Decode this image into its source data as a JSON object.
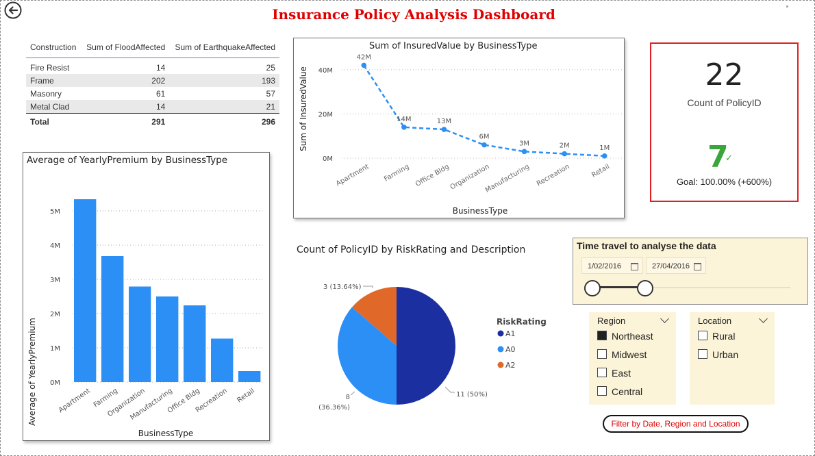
{
  "header": {
    "title": "Insurance Policy Analysis Dashboard",
    "back_icon": "arrow-left-circle-icon"
  },
  "table": {
    "columns": [
      "Construction",
      "Sum of FloodAffected",
      "Sum of EarthquakeAffected"
    ],
    "rows": [
      {
        "construction": "Fire Resist",
        "flood": "14",
        "quake": "25"
      },
      {
        "construction": "Frame",
        "flood": "202",
        "quake": "193"
      },
      {
        "construction": "Masonry",
        "flood": "61",
        "quake": "57"
      },
      {
        "construction": "Metal Clad",
        "flood": "14",
        "quake": "21"
      }
    ],
    "total": {
      "label": "Total",
      "flood": "291",
      "quake": "296"
    }
  },
  "kpi": {
    "count": "22",
    "count_label": "Count of PolicyID",
    "value": "7",
    "goal": "Goal: 100.00% (+600%)",
    "value_color": "#3aa53a",
    "border_color": "#e02020"
  },
  "time_slicer": {
    "title": "Time travel to analyse the data",
    "start_date": "1/02/2016",
    "end_date": "27/04/2016"
  },
  "region_filter": {
    "title": "Region",
    "options": [
      {
        "label": "Northeast",
        "checked": true
      },
      {
        "label": "Midwest",
        "checked": false
      },
      {
        "label": "East",
        "checked": false
      },
      {
        "label": "Central",
        "checked": false
      }
    ]
  },
  "location_filter": {
    "title": "Location",
    "options": [
      {
        "label": "Rural",
        "checked": false
      },
      {
        "label": "Urban",
        "checked": false
      }
    ]
  },
  "filter_note": "Filter by Date, Region and Location",
  "chart_data": [
    {
      "type": "bar",
      "title": "Average of YearlyPremium by BusinessType",
      "xlabel": "BusinessType",
      "ylabel": "Average of YearlyPremium",
      "categories": [
        "Apartment",
        "Farming",
        "Organization",
        "Manufacturing",
        "Office Bldg",
        "Recreation",
        "Retail"
      ],
      "values": [
        5340000,
        3680000,
        2790000,
        2500000,
        2240000,
        1270000,
        320000
      ],
      "ylim": [
        0,
        5500000
      ],
      "yticks": [
        "0M",
        "1M",
        "2M",
        "3M",
        "4M",
        "5M"
      ],
      "grid": true,
      "color": "#2b8ff5"
    },
    {
      "type": "line",
      "title": "Sum of InsuredValue by BusinessType",
      "xlabel": "BusinessType",
      "ylabel": "Sum of InsuredValue",
      "categories": [
        "Apartment",
        "Farming",
        "Office Bldg",
        "Organization",
        "Manufacturing",
        "Recreation",
        "Retail"
      ],
      "values": [
        42000000,
        14000000,
        13000000,
        6000000,
        3000000,
        2000000,
        1000000
      ],
      "data_labels": [
        "42M",
        "14M",
        "13M",
        "6M",
        "3M",
        "2M",
        "1M"
      ],
      "ylim": [
        0,
        48000000
      ],
      "yticks": [
        "0M",
        "20M",
        "40M"
      ],
      "grid": true,
      "line_style": "dashed",
      "color": "#2b8ff5"
    },
    {
      "type": "pie",
      "title": "Count of PolicyID by RiskRating and Description",
      "legend_title": "RiskRating",
      "legend_position": "right",
      "slices": [
        {
          "label": "A1",
          "value": 11,
          "text": "11 (50%)",
          "color": "#1c2fa0"
        },
        {
          "label": "A0",
          "value": 8,
          "text": "8 (36.36%)",
          "color": "#2b8ff5"
        },
        {
          "label": "A2",
          "value": 3,
          "text": "3 (13.64%)",
          "color": "#e0692a"
        }
      ]
    }
  ]
}
